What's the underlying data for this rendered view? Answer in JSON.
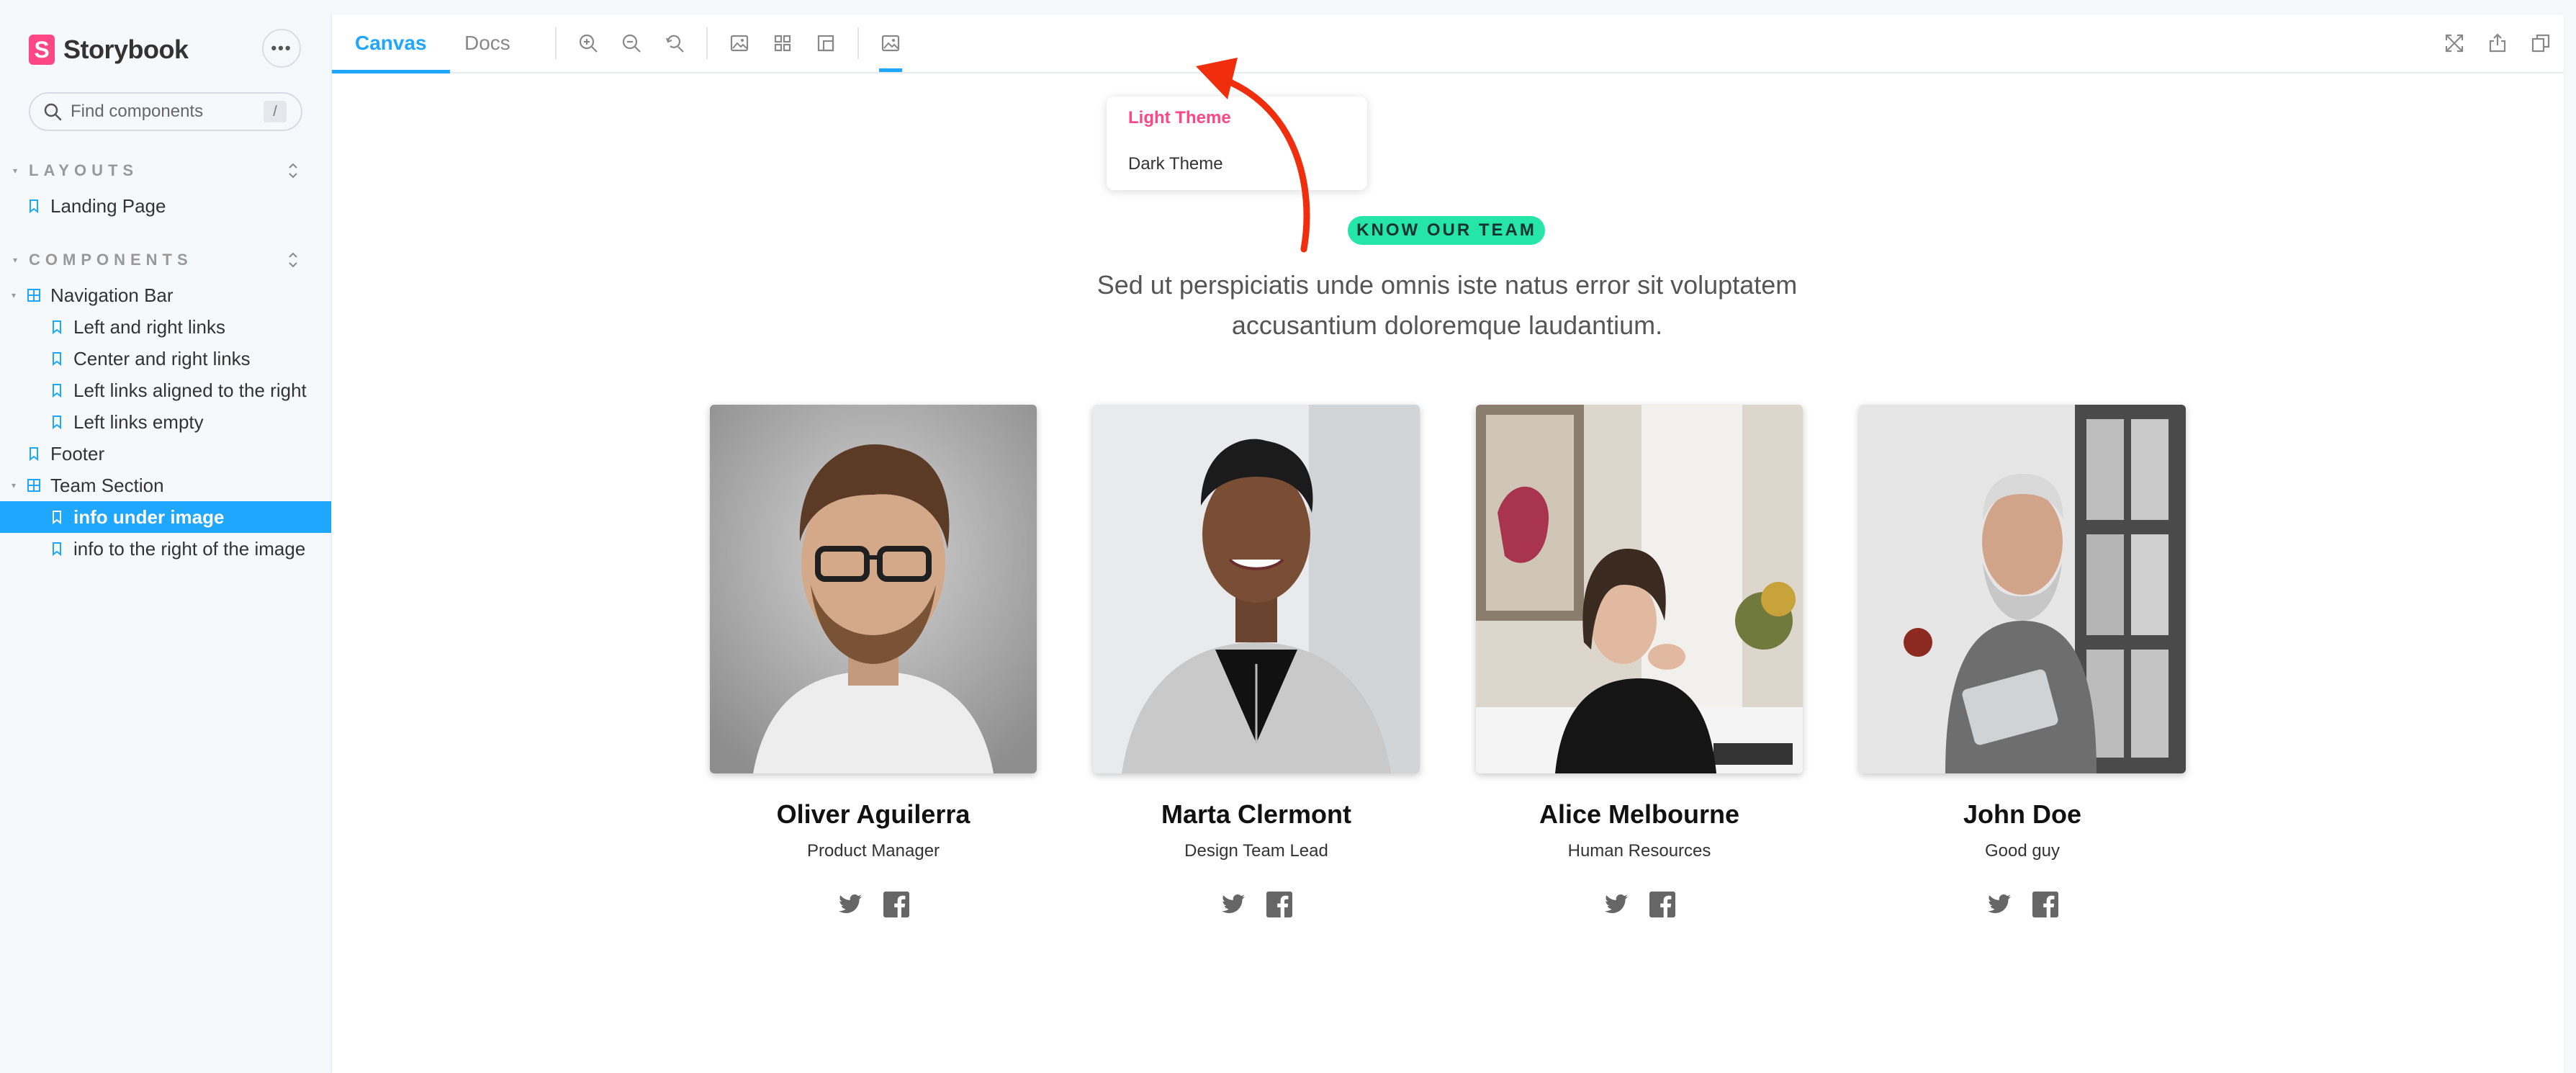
{
  "brand": {
    "logo_letter": "S",
    "name": "Storybook"
  },
  "sidebar": {
    "menu_label": "•••",
    "search": {
      "placeholder": "Find components",
      "shortcut": "/"
    },
    "groups": [
      {
        "title": "LAYOUTS"
      },
      {
        "title": "COMPONENTS"
      }
    ],
    "items": [
      {
        "label": "Landing Page",
        "type": "story"
      },
      {
        "label": "Navigation Bar",
        "type": "component"
      },
      {
        "label": "Left and right links",
        "type": "story"
      },
      {
        "label": "Center and right links",
        "type": "story"
      },
      {
        "label": "Left links aligned to the right",
        "type": "story"
      },
      {
        "label": "Left links empty",
        "type": "story"
      },
      {
        "label": "Footer",
        "type": "story"
      },
      {
        "label": "Team Section",
        "type": "component"
      },
      {
        "label": "info under image",
        "type": "story",
        "selected": true
      },
      {
        "label": "info to the right of the image",
        "type": "story"
      }
    ]
  },
  "toolbar": {
    "tabs": [
      {
        "label": "Canvas",
        "active": true
      },
      {
        "label": "Docs",
        "active": false
      }
    ],
    "icons": [
      "zoom-in-icon",
      "zoom-out-icon",
      "zoom-reset-icon",
      "background-icon",
      "grid-icon",
      "measure-icon",
      "theme-icon"
    ],
    "right_icons": [
      "fullscreen-icon",
      "share-icon",
      "copy-icon"
    ]
  },
  "theme_menu": {
    "options": [
      {
        "label": "Light Theme",
        "active": true
      },
      {
        "label": "Dark Theme",
        "active": false
      }
    ]
  },
  "content": {
    "badge": "KNOW OUR TEAM",
    "subtitle_line1": "Sed ut perspiciatis unde omnis iste natus error sit voluptatem",
    "subtitle_line2": "accusantium doloremque laudantium.",
    "team": [
      {
        "name": "Oliver Aguilerra",
        "role": "Product Manager"
      },
      {
        "name": "Marta Clermont",
        "role": "Design Team Lead"
      },
      {
        "name": "Alice Melbourne",
        "role": "Human Resources"
      },
      {
        "name": "John Doe",
        "role": "Good guy"
      }
    ]
  },
  "colors": {
    "accent_blue": "#1ea7fd",
    "accent_pink": "#ff4785",
    "badge_green": "#25e6a7",
    "annotation_red": "#f02d0c"
  }
}
